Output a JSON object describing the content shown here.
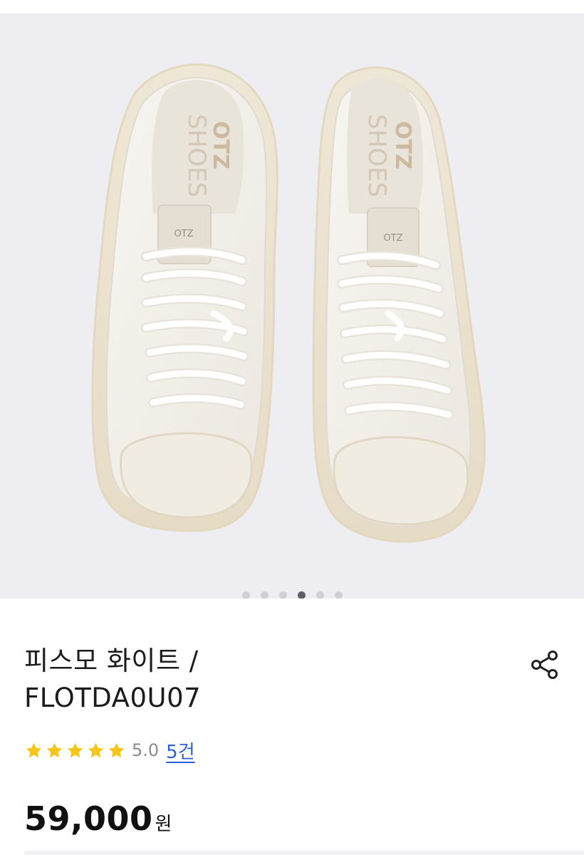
{
  "gallery": {
    "logo_text": "OTZ",
    "insole_brand": "OTZ",
    "insole_text": "SHOES",
    "tongue_label": "OTZ",
    "dots_count": 6,
    "active_dot": 3
  },
  "product": {
    "title_line1": "피스모 화이트 /",
    "title_line2": "FLOTDA0U07",
    "rating_stars": 5,
    "rating_score": "5.0",
    "review_count": "5건",
    "price": "59,000",
    "currency": "원"
  },
  "colors": {
    "gallery_bg": "#eeeef2",
    "shoe_body": "#f5f2ec",
    "sole": "#ece4d4",
    "star": "#f5c518",
    "review_link": "#2b5fd9",
    "active_dot": "#5f5f66"
  },
  "icons": {
    "share": "share-icon",
    "star": "star-icon"
  }
}
